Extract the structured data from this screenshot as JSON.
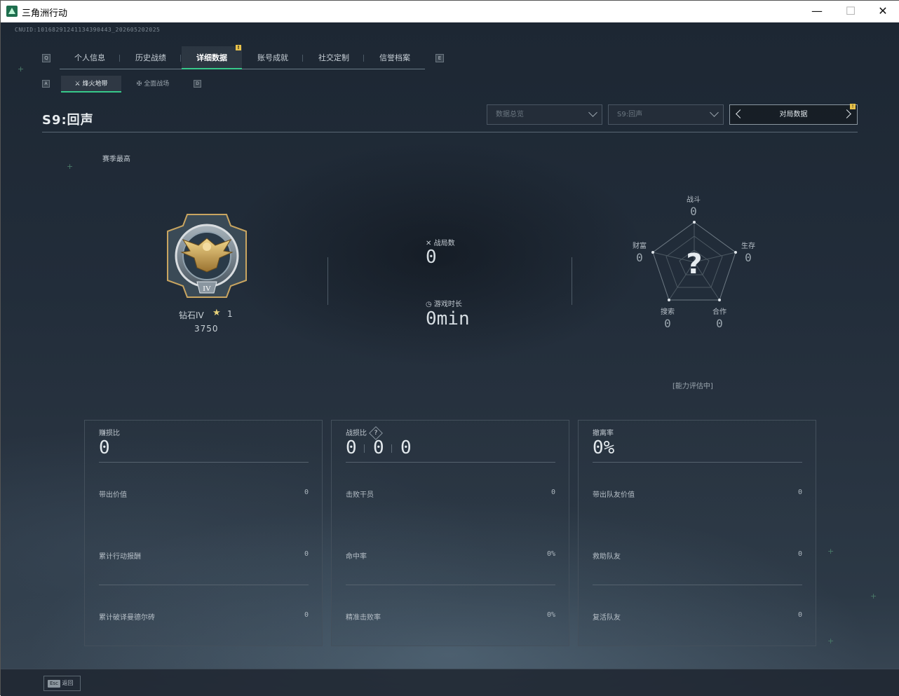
{
  "window": {
    "title": "三角洲行动"
  },
  "uid": "CNUID:1016829124113439044З_202605202025",
  "tabs": [
    {
      "label": "个人信息"
    },
    {
      "label": "历史战绩"
    },
    {
      "label": "详细数据",
      "active": true
    },
    {
      "label": "账号成就"
    },
    {
      "label": "社交定制"
    },
    {
      "label": "信誉档案"
    }
  ],
  "tab_keys": {
    "left": "Q",
    "right": "E"
  },
  "subtabs": [
    {
      "label": "烽火地带",
      "active": true
    },
    {
      "label": "全面战场"
    }
  ],
  "subtab_keys": {
    "left": "A",
    "right": "D"
  },
  "season_title": "S9:回声",
  "dropdowns": [
    {
      "value": "数据总览"
    },
    {
      "value": "S9:回声"
    }
  ],
  "pager_label": "对局数据",
  "season_best": "赛季最高",
  "rank": {
    "name": "钻石IV",
    "stars": "1",
    "score": "3750"
  },
  "matches": {
    "label": "战局数",
    "value": "0"
  },
  "playtime": {
    "label": "游戏时长",
    "value": "0min"
  },
  "radar": {
    "combat": {
      "label": "战斗",
      "value": "0"
    },
    "survival": {
      "label": "生存",
      "value": "0"
    },
    "cooperation": {
      "label": "合作",
      "value": "0"
    },
    "search": {
      "label": "搜索",
      "value": "0"
    },
    "wealth": {
      "label": "财富",
      "value": "0"
    },
    "unknown": "?",
    "status": "[能力评估中]"
  },
  "cards": [
    {
      "title": "赚损比",
      "value": "0",
      "rows": [
        {
          "label": "带出价值",
          "value": "0"
        },
        {
          "label": "累计行动报酬",
          "value": "0"
        },
        {
          "label": "累计破译曼德尔砖",
          "value": "0"
        }
      ]
    },
    {
      "title": "战损比",
      "values": [
        "0",
        "0",
        "0"
      ],
      "help": "?",
      "rows": [
        {
          "label": "击败干员",
          "value": "0"
        },
        {
          "label": "命中率",
          "value": "0%"
        },
        {
          "label": "精准击败率",
          "value": "0%"
        }
      ]
    },
    {
      "title": "撤离率",
      "value": "0%",
      "rows": [
        {
          "label": "带出队友价值",
          "value": "0"
        },
        {
          "label": "救助队友",
          "value": "0"
        },
        {
          "label": "复活队友",
          "value": "0"
        }
      ]
    }
  ],
  "footer": {
    "esc_key": "Esc",
    "esc_label": "返回"
  },
  "colors": {
    "accent": "#37c98a",
    "badge": "#e8c24a",
    "background": "#222d3a"
  }
}
